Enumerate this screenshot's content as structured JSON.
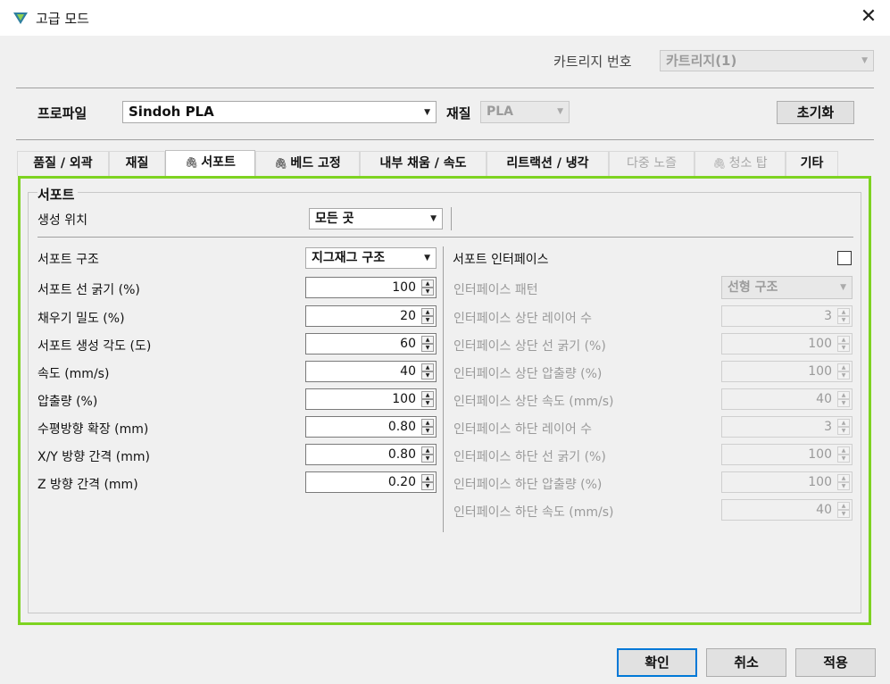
{
  "window": {
    "title": "고급 모드"
  },
  "cartridge": {
    "label": "카트리지 번호",
    "value": "카트리지(1)"
  },
  "profile": {
    "label": "프로파일",
    "value": "Sindoh PLA",
    "material_label": "재질",
    "material_value": "PLA",
    "reset_label": "초기화"
  },
  "tabs": [
    {
      "label": "품질 / 외곽"
    },
    {
      "label": "재질"
    },
    {
      "label": "서포트"
    },
    {
      "label": "베드 고정"
    },
    {
      "label": "내부 채움 / 속도"
    },
    {
      "label": "리트랙션 / 냉각"
    },
    {
      "label": "다중 노즐"
    },
    {
      "label": "청소 탑"
    },
    {
      "label": "기타"
    }
  ],
  "support": {
    "group_title": "서포트",
    "placement_label": "생성 위치",
    "placement_value": "모든 곳",
    "structure_label": "서포트 구조",
    "structure_value": "지그재그 구조",
    "fields": [
      {
        "label": "서포트 선 굵기 (%)",
        "value": "100"
      },
      {
        "label": "채우기 밀도 (%)",
        "value": "20"
      },
      {
        "label": "서포트 생성 각도 (도)",
        "value": "60"
      },
      {
        "label": "속도 (mm/s)",
        "value": "40"
      },
      {
        "label": "압출량 (%)",
        "value": "100"
      },
      {
        "label": "수평방향 확장 (mm)",
        "value": "0.80"
      },
      {
        "label": "X/Y 방향 간격 (mm)",
        "value": "0.80"
      },
      {
        "label": "Z 방향 간격 (mm)",
        "value": "0.20"
      }
    ]
  },
  "interface": {
    "label": "서포트 인터페이스",
    "checked": false,
    "pattern_label": "인터페이스 패턴",
    "pattern_value": "선형 구조",
    "fields": [
      {
        "label": "인터페이스 상단 레이어 수",
        "value": "3"
      },
      {
        "label": "인터페이스 상단 선 굵기 (%)",
        "value": "100"
      },
      {
        "label": "인터페이스 상단 압출량 (%)",
        "value": "100"
      },
      {
        "label": "인터페이스 상단 속도 (mm/s)",
        "value": "40"
      },
      {
        "label": "인터페이스 하단 레이어 수",
        "value": "3"
      },
      {
        "label": "인터페이스 하단 선 굵기 (%)",
        "value": "100"
      },
      {
        "label": "인터페이스 하단 압출량 (%)",
        "value": "100"
      },
      {
        "label": "인터페이스 하단 속도 (mm/s)",
        "value": "40"
      }
    ]
  },
  "buttons": {
    "ok": "확인",
    "cancel": "취소",
    "apply": "적용"
  },
  "colors": {
    "highlight_border": "#7ed321",
    "primary_border": "#0078d7"
  }
}
